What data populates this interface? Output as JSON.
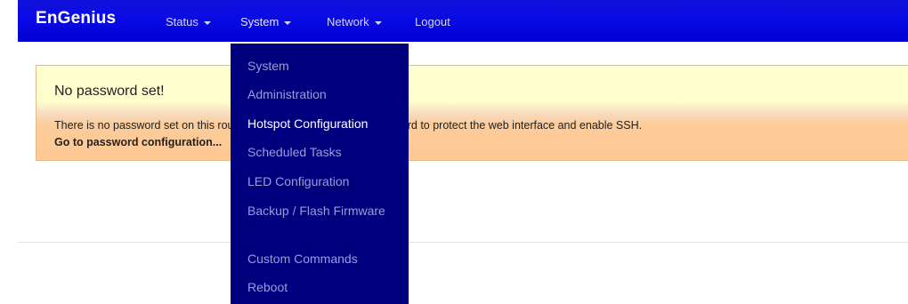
{
  "brand": "EnGenius",
  "nav": {
    "status": "Status",
    "system": "System",
    "network": "Network",
    "logout": "Logout"
  },
  "alert": {
    "title": "No password set!",
    "text": "There is no password set on this router. Please configure a root password to protect the web interface and enable SSH.",
    "link": "Go to password configuration..."
  },
  "system_menu": {
    "items": [
      "System",
      "Administration",
      "Hotspot Configuration",
      "Scheduled Tasks",
      "LED Configuration",
      "Backup / Flash Firmware",
      "Custom Commands",
      "Reboot"
    ],
    "highlighted": "Hotspot Configuration"
  },
  "colors": {
    "navbar": "#0a0ae6",
    "dropdown": "#00007f",
    "alert_top": "#fefecc",
    "alert_bottom": "#ffc894"
  }
}
